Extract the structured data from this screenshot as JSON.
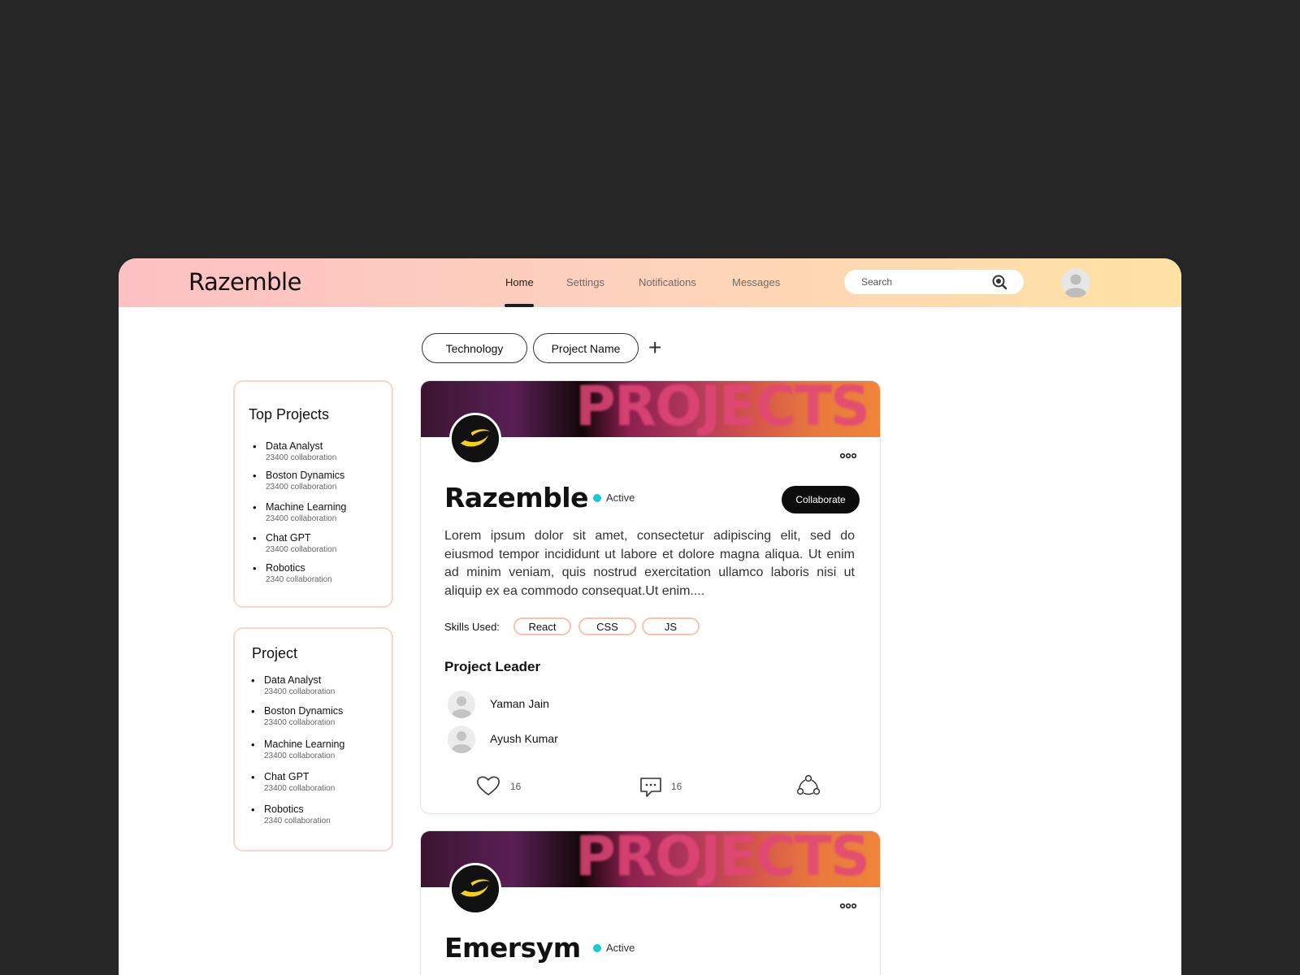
{
  "header": {
    "brand": "Razemble",
    "nav": [
      "Home",
      "Settings",
      "Notifications",
      "Messages"
    ],
    "active_nav": "Home",
    "search_placeholder": "Search"
  },
  "filters": {
    "chips": [
      "Technology",
      "Project Name"
    ],
    "add_label": "+"
  },
  "top_projects": {
    "title": "Top Projects",
    "items": [
      {
        "name": "Data Analyst",
        "count": "23400  collaboration"
      },
      {
        "name": "Boston Dynamics",
        "count": "23400  collaboration"
      },
      {
        "name": "Machine Learning",
        "count": "23400  collaboration"
      },
      {
        "name": "Chat GPT",
        "count": "23400  collaboration"
      },
      {
        "name": "Robotics",
        "count": "2340 collaboration"
      }
    ]
  },
  "project": {
    "title": "Project",
    "items": [
      {
        "name": "Data Analyst",
        "count": "23400  collaboration"
      },
      {
        "name": "Boston Dynamics",
        "count": "23400  collaboration"
      },
      {
        "name": "Machine Learning",
        "count": "23400  collaboration"
      },
      {
        "name": "Chat GPT",
        "count": "23400  collaboration"
      },
      {
        "name": "Robotics",
        "count": "2340 collaboration"
      }
    ]
  },
  "posts": [
    {
      "banner_text": "PROJECTS",
      "title": "Razemble",
      "status": "Active",
      "collaborate_label": "Collaborate",
      "description": "Lorem ipsum dolor sit amet, consectetur adipiscing elit, sed do eiusmod tempor incididunt ut labore et dolore magna aliqua. Ut enim ad minim veniam, quis nostrud exercitation ullamco laboris nisi ut aliquip ex ea commodo consequat.Ut enim....",
      "skills_label": "Skills Used:",
      "skills": [
        "React",
        "CSS",
        "JS"
      ],
      "leader_title": "Project Leader",
      "leaders": [
        "Yaman Jain",
        "Ayush Kumar"
      ],
      "likes": "16",
      "comments": "16"
    },
    {
      "banner_text": "PROJECTS",
      "title": "Emersym",
      "status": "Active"
    }
  ],
  "colors": {
    "status_active": "#19c9d6",
    "header_gradient_start": "#fdc0c3",
    "header_gradient_end": "#fee2a4",
    "skill_border": "#f9c2a9"
  }
}
